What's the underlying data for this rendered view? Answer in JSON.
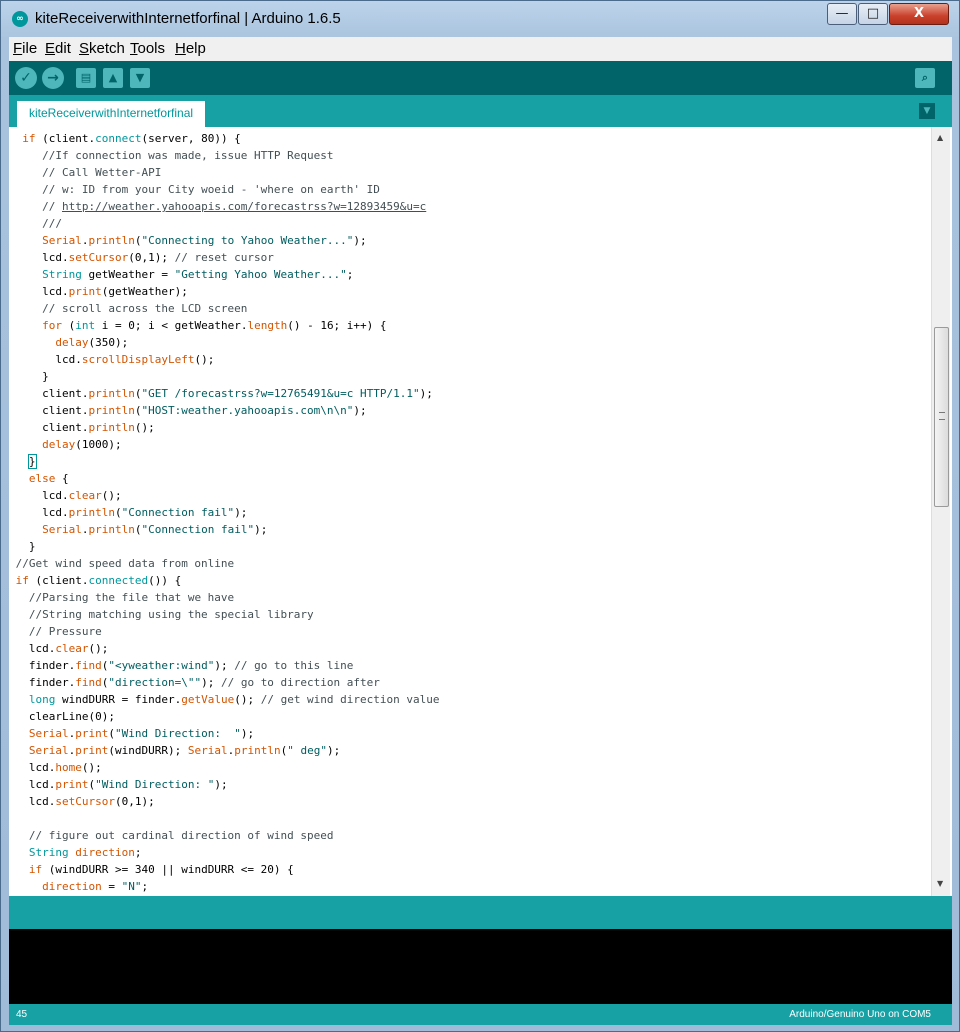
{
  "window": {
    "title": "kiteReceiverwithInternetforfinal | Arduino 1.6.5",
    "close_glyph": "X",
    "min_glyph": "—",
    "max_glyph": "□"
  },
  "menu": [
    {
      "label": "File",
      "accel": "F",
      "rest": "ile"
    },
    {
      "label": "Edit",
      "accel": "E",
      "rest": "dit"
    },
    {
      "label": "Sketch",
      "accel": "S",
      "rest": "ketch"
    },
    {
      "label": "Tools",
      "accel": "T",
      "rest": "ools"
    },
    {
      "label": "Help",
      "accel": "H",
      "rest": "elp"
    }
  ],
  "toolbar": {
    "verify": "verify-icon",
    "upload": "upload-icon",
    "new": "new-icon",
    "open": "open-icon",
    "save": "save-icon",
    "serial": "serial-monitor-icon"
  },
  "tab": {
    "label": "kiteReceiverwithInternetforfinal"
  },
  "code_lines": [
    [
      [
        "p",
        "  "
      ],
      [
        "k",
        "if"
      ],
      [
        "p",
        " (client."
      ],
      [
        "f",
        "connect"
      ],
      [
        "p",
        "(server, 80)) {"
      ]
    ],
    [
      [
        "p",
        "     "
      ],
      [
        "c",
        "//If connection was made, issue HTTP Request"
      ]
    ],
    [
      [
        "p",
        "     "
      ],
      [
        "c",
        "// Call Wetter-API"
      ]
    ],
    [
      [
        "p",
        "     "
      ],
      [
        "c",
        "// w: ID from your City woeid - 'where on earth' ID"
      ]
    ],
    [
      [
        "p",
        "     "
      ],
      [
        "c",
        "// "
      ],
      [
        "u",
        "http://weather.yahooapis.com/forecastrss?w=12893459&u=c"
      ]
    ],
    [
      [
        "p",
        "     "
      ],
      [
        "c",
        "///"
      ]
    ],
    [
      [
        "p",
        "     "
      ],
      [
        "k",
        "Serial"
      ],
      [
        "p",
        "."
      ],
      [
        "k",
        "println"
      ],
      [
        "p",
        "("
      ],
      [
        "s",
        "\"Connecting to Yahoo Weather...\""
      ],
      [
        "p",
        ");"
      ]
    ],
    [
      [
        "p",
        "     lcd."
      ],
      [
        "k",
        "setCursor"
      ],
      [
        "p",
        "(0,1); "
      ],
      [
        "c",
        "// reset cursor"
      ]
    ],
    [
      [
        "p",
        "     "
      ],
      [
        "t",
        "String"
      ],
      [
        "p",
        " getWeather = "
      ],
      [
        "s",
        "\"Getting Yahoo Weather...\""
      ],
      [
        "p",
        ";"
      ]
    ],
    [
      [
        "p",
        "     lcd."
      ],
      [
        "k",
        "print"
      ],
      [
        "p",
        "(getWeather);"
      ]
    ],
    [
      [
        "p",
        "     "
      ],
      [
        "c",
        "// scroll across the LCD screen"
      ]
    ],
    [
      [
        "p",
        "     "
      ],
      [
        "k",
        "for"
      ],
      [
        "p",
        " ("
      ],
      [
        "t",
        "int"
      ],
      [
        "p",
        " i = 0; i < getWeather."
      ],
      [
        "k",
        "length"
      ],
      [
        "p",
        "() - 16; i++) {"
      ]
    ],
    [
      [
        "p",
        "       "
      ],
      [
        "k",
        "delay"
      ],
      [
        "p",
        "(350);"
      ]
    ],
    [
      [
        "p",
        "       lcd."
      ],
      [
        "k",
        "scrollDisplayLeft"
      ],
      [
        "p",
        "();"
      ]
    ],
    [
      [
        "p",
        "     }"
      ]
    ],
    [
      [
        "p",
        "     client."
      ],
      [
        "k",
        "println"
      ],
      [
        "p",
        "("
      ],
      [
        "s",
        "\"GET /forecastrss?w=12765491&u=c HTTP/1.1\""
      ],
      [
        "p",
        ");"
      ]
    ],
    [
      [
        "p",
        "     client."
      ],
      [
        "k",
        "println"
      ],
      [
        "p",
        "("
      ],
      [
        "s",
        "\"HOST:weather.yahooapis.com\\n\\n\""
      ],
      [
        "p",
        ");"
      ]
    ],
    [
      [
        "p",
        "     client."
      ],
      [
        "k",
        "println"
      ],
      [
        "p",
        "();"
      ]
    ],
    [
      [
        "p",
        "     "
      ],
      [
        "k",
        "delay"
      ],
      [
        "p",
        "(1000);"
      ]
    ],
    [
      [
        "p",
        "   "
      ],
      [
        "b",
        "}"
      ]
    ],
    [
      [
        "p",
        "   "
      ],
      [
        "k",
        "else"
      ],
      [
        "p",
        " {"
      ]
    ],
    [
      [
        "p",
        "     lcd."
      ],
      [
        "k",
        "clear"
      ],
      [
        "p",
        "();"
      ]
    ],
    [
      [
        "p",
        "     lcd."
      ],
      [
        "k",
        "println"
      ],
      [
        "p",
        "("
      ],
      [
        "s",
        "\"Connection fail\""
      ],
      [
        "p",
        ");"
      ]
    ],
    [
      [
        "p",
        "     "
      ],
      [
        "k",
        "Serial"
      ],
      [
        "p",
        "."
      ],
      [
        "k",
        "println"
      ],
      [
        "p",
        "("
      ],
      [
        "s",
        "\"Connection fail\""
      ],
      [
        "p",
        ");"
      ]
    ],
    [
      [
        "p",
        "   }"
      ]
    ],
    [
      [
        "p",
        " "
      ],
      [
        "c",
        "//Get wind speed data from online"
      ]
    ],
    [
      [
        "p",
        " "
      ],
      [
        "k",
        "if"
      ],
      [
        "p",
        " (client."
      ],
      [
        "f",
        "connected"
      ],
      [
        "p",
        "()) {"
      ]
    ],
    [
      [
        "p",
        "   "
      ],
      [
        "c",
        "//Parsing the file that we have"
      ]
    ],
    [
      [
        "p",
        "   "
      ],
      [
        "c",
        "//String matching using the special library"
      ]
    ],
    [
      [
        "p",
        "   "
      ],
      [
        "c",
        "// Pressure"
      ]
    ],
    [
      [
        "p",
        "   lcd."
      ],
      [
        "k",
        "clear"
      ],
      [
        "p",
        "();"
      ]
    ],
    [
      [
        "p",
        "   finder."
      ],
      [
        "k",
        "find"
      ],
      [
        "p",
        "("
      ],
      [
        "s",
        "\"<yweather:wind\""
      ],
      [
        "p",
        "); "
      ],
      [
        "c",
        "// go to this line"
      ]
    ],
    [
      [
        "p",
        "   finder."
      ],
      [
        "k",
        "find"
      ],
      [
        "p",
        "("
      ],
      [
        "s",
        "\"direction=\\\"\""
      ],
      [
        "p",
        "); "
      ],
      [
        "c",
        "// go to direction after"
      ]
    ],
    [
      [
        "p",
        "   "
      ],
      [
        "t",
        "long"
      ],
      [
        "p",
        " windDURR = finder."
      ],
      [
        "k",
        "getValue"
      ],
      [
        "p",
        "(); "
      ],
      [
        "c",
        "// get wind direction value"
      ]
    ],
    [
      [
        "p",
        "   clearLine(0);"
      ]
    ],
    [
      [
        "p",
        "   "
      ],
      [
        "k",
        "Serial"
      ],
      [
        "p",
        "."
      ],
      [
        "k",
        "print"
      ],
      [
        "p",
        "("
      ],
      [
        "s",
        "\"Wind Direction:  \""
      ],
      [
        "p",
        ");"
      ]
    ],
    [
      [
        "p",
        "   "
      ],
      [
        "k",
        "Serial"
      ],
      [
        "p",
        "."
      ],
      [
        "k",
        "print"
      ],
      [
        "p",
        "(windDURR); "
      ],
      [
        "k",
        "Serial"
      ],
      [
        "p",
        "."
      ],
      [
        "k",
        "println"
      ],
      [
        "p",
        "("
      ],
      [
        "s",
        "\" deg\""
      ],
      [
        "p",
        ");"
      ]
    ],
    [
      [
        "p",
        "   lcd."
      ],
      [
        "k",
        "home"
      ],
      [
        "p",
        "();"
      ]
    ],
    [
      [
        "p",
        "   lcd."
      ],
      [
        "k",
        "print"
      ],
      [
        "p",
        "("
      ],
      [
        "s",
        "\"Wind Direction: \""
      ],
      [
        "p",
        ");"
      ]
    ],
    [
      [
        "p",
        "   lcd."
      ],
      [
        "k",
        "setCursor"
      ],
      [
        "p",
        "(0,1);"
      ]
    ],
    [
      [
        "p",
        ""
      ]
    ],
    [
      [
        "p",
        "   "
      ],
      [
        "c",
        "// figure out cardinal direction of wind speed"
      ]
    ],
    [
      [
        "p",
        "   "
      ],
      [
        "t",
        "String"
      ],
      [
        "p",
        " "
      ],
      [
        "k",
        "direction"
      ],
      [
        "p",
        ";"
      ]
    ],
    [
      [
        "p",
        "   "
      ],
      [
        "k",
        "if"
      ],
      [
        "p",
        " (windDURR >= 340 || windDURR <= 20) {"
      ]
    ],
    [
      [
        "p",
        "     "
      ],
      [
        "k",
        "direction"
      ],
      [
        "p",
        " = "
      ],
      [
        "s",
        "\"N\""
      ],
      [
        "p",
        ";"
      ]
    ]
  ],
  "status": {
    "line_number": "45",
    "board": "Arduino/Genuino Uno on COM5"
  },
  "colors": {
    "keyword": "#d35400",
    "function": "#00979c",
    "string": "#005c5f",
    "comment": "#434f54",
    "toolbar_bg": "#006468",
    "tabbar_bg": "#17a1a5"
  }
}
